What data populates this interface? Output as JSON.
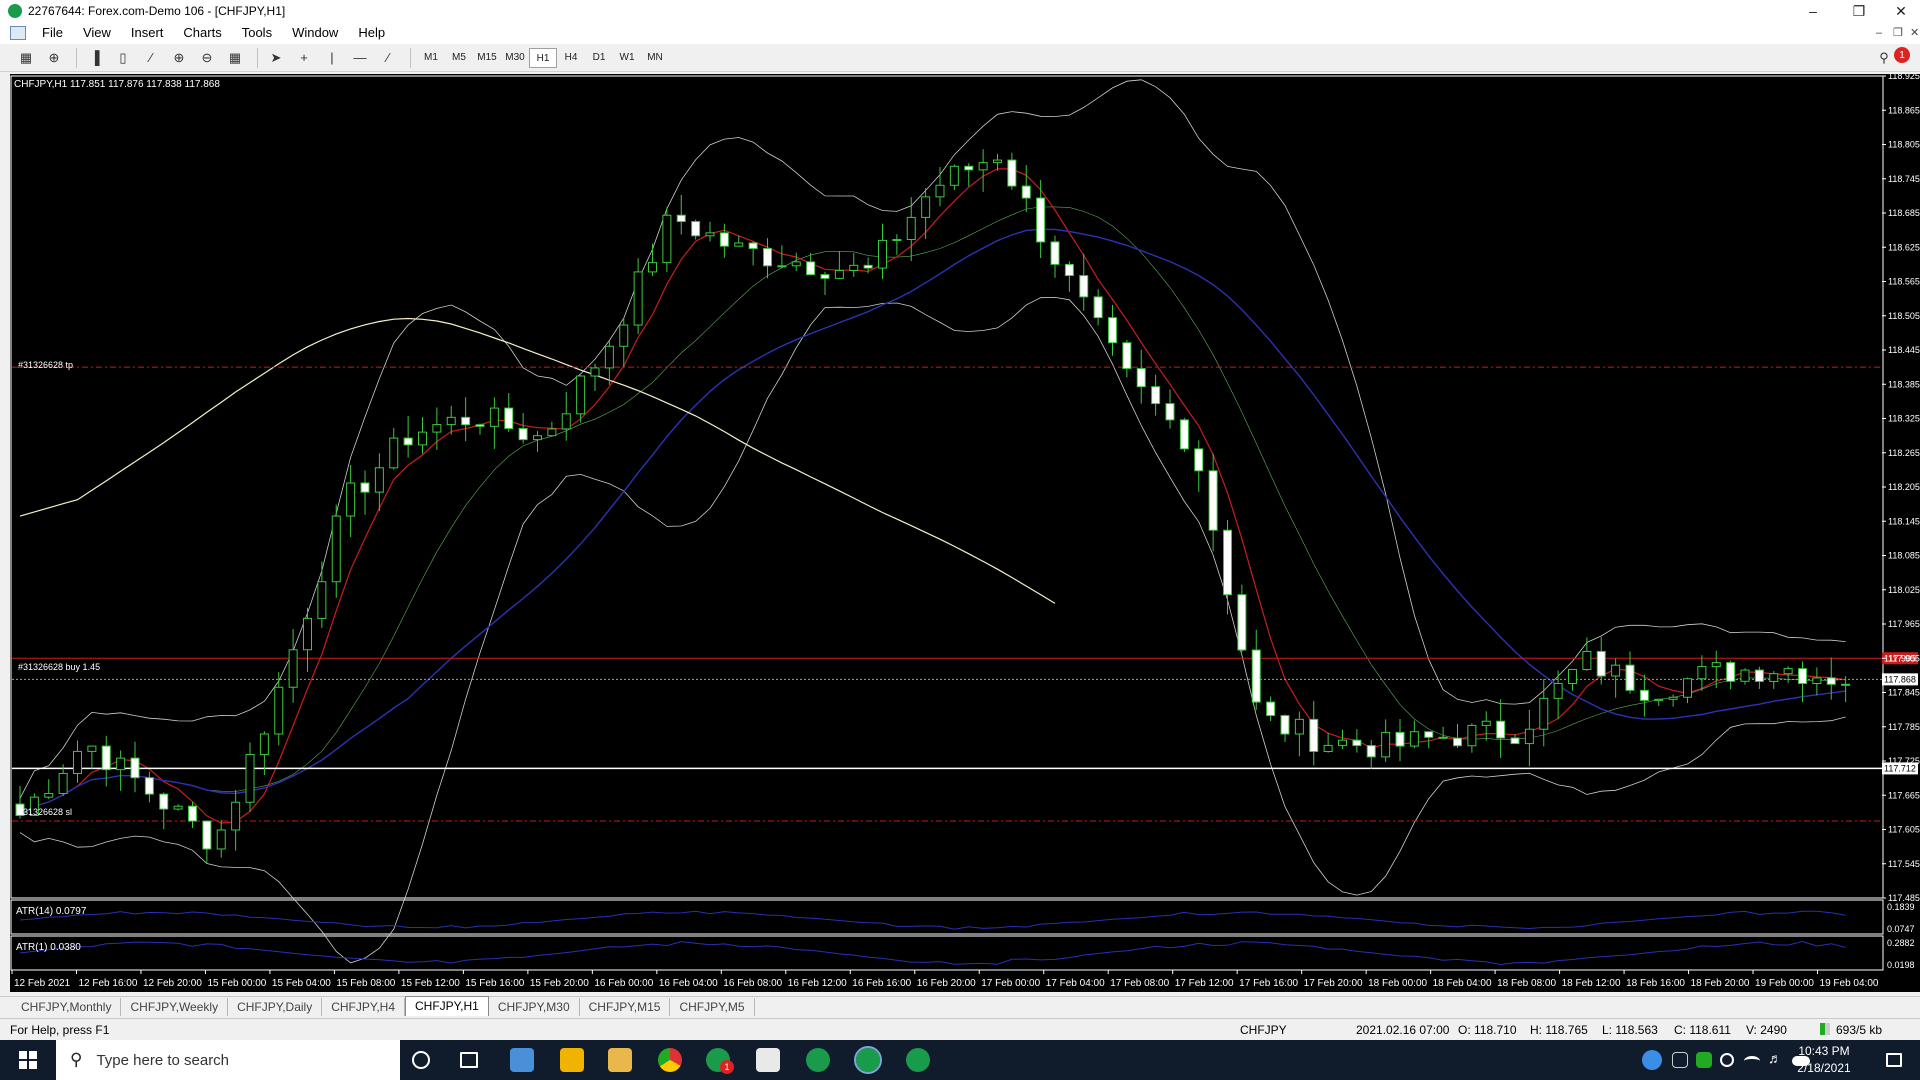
{
  "window": {
    "title": "22767644: Forex.com-Demo 106 - [CHFJPY,H1]"
  },
  "menu": [
    "File",
    "View",
    "Insert",
    "Charts",
    "Tools",
    "Window",
    "Help"
  ],
  "timeframes": [
    "M1",
    "M5",
    "M15",
    "M30",
    "H1",
    "H4",
    "D1",
    "W1",
    "MN"
  ],
  "active_timeframe": "H1",
  "chart": {
    "header": "CHFJPY,H1  117.851 117.876 117.838 117.868",
    "tp_label": "#31326628 tp",
    "buy_label": "#31326628 buy 1.45",
    "sl_label": "#31326628 sl",
    "price_labels": [
      "118.925",
      "118.865",
      "118.805",
      "118.745",
      "118.685",
      "118.625",
      "118.565",
      "118.505",
      "118.445",
      "118.385",
      "118.325",
      "118.265",
      "118.205",
      "118.145",
      "118.085",
      "118.025",
      "117.965",
      "117.905",
      "117.845",
      "117.785",
      "117.725",
      "117.665",
      "117.605",
      "117.545",
      "117.485"
    ],
    "current_price": "117.868",
    "buy_price_tag": "117.905",
    "hline_price": "117.712",
    "atr14_label": "ATR(14) 0.0797",
    "atr14_scale": [
      "0.1839",
      "0.0747"
    ],
    "atr1_label": "ATR(1) 0.0380",
    "atr1_scale": [
      "0.2882",
      "0.0198"
    ],
    "time_labels": [
      "12 Feb 2021",
      "12 Feb 16:00",
      "12 Feb 20:00",
      "15 Feb 00:00",
      "15 Feb 04:00",
      "15 Feb 08:00",
      "15 Feb 12:00",
      "15 Feb 16:00",
      "15 Feb 20:00",
      "16 Feb 00:00",
      "16 Feb 04:00",
      "16 Feb 08:00",
      "16 Feb 12:00",
      "16 Feb 16:00",
      "16 Feb 20:00",
      "17 Feb 00:00",
      "17 Feb 04:00",
      "17 Feb 08:00",
      "17 Feb 12:00",
      "17 Feb 16:00",
      "17 Feb 20:00",
      "18 Feb 00:00",
      "18 Feb 04:00",
      "18 Feb 08:00",
      "18 Feb 12:00",
      "18 Feb 16:00",
      "18 Feb 20:00",
      "19 Feb 00:00",
      "19 Feb 04:00"
    ],
    "colors": {
      "background": "#000000",
      "bull_candle": "#000000",
      "bear_candle": "#ffffff",
      "wick": "#3cc83c",
      "ma_fast": "#c81e1e",
      "ma_slow": "#2d32b4",
      "ma_long": "#f5f0c8",
      "bands": "#c8d2c8",
      "tp_sl_line": "#c81e1e",
      "buy_line": "#c81e1e",
      "atr": "#2830b4"
    }
  },
  "chart_data": {
    "type": "candlestick",
    "symbol": "CHFJPY",
    "timeframe": "H1",
    "ylim": [
      117.485,
      118.925
    ],
    "x": [
      "12 Feb 2021",
      "12 Feb 16:00",
      "12 Feb 20:00",
      "15 Feb 00:00",
      "15 Feb 04:00",
      "15 Feb 08:00",
      "15 Feb 12:00",
      "15 Feb 16:00",
      "15 Feb 20:00",
      "16 Feb 00:00",
      "16 Feb 04:00",
      "16 Feb 08:00",
      "16 Feb 12:00",
      "16 Feb 16:00",
      "16 Feb 20:00",
      "17 Feb 00:00",
      "17 Feb 04:00",
      "17 Feb 08:00",
      "17 Feb 12:00",
      "17 Feb 16:00",
      "17 Feb 20:00",
      "18 Feb 00:00",
      "18 Feb 04:00",
      "18 Feb 08:00",
      "18 Feb 12:00",
      "18 Feb 16:00",
      "18 Feb 20:00",
      "19 Feb 00:00",
      "19 Feb 04:00"
    ],
    "close_approx": [
      117.63,
      117.76,
      117.67,
      117.58,
      117.86,
      118.18,
      118.3,
      118.33,
      118.29,
      118.45,
      118.68,
      118.62,
      118.6,
      118.58,
      118.73,
      118.79,
      118.58,
      118.39,
      118.28,
      117.8,
      117.76,
      117.75,
      117.77,
      117.78,
      117.9,
      117.85,
      117.88,
      117.89,
      117.868
    ],
    "levels": {
      "tp": 118.415,
      "buy": 117.905,
      "sl": 117.62,
      "horizontal_line": 117.712,
      "current": 117.868
    },
    "indicators": [
      "ATR(14) 0.0797",
      "ATR(1) 0.0380"
    ]
  },
  "tabs": [
    "CHFJPY,Monthly",
    "CHFJPY,Weekly",
    "CHFJPY,Daily",
    "CHFJPY,H4",
    "CHFJPY,H1",
    "CHFJPY,M30",
    "CHFJPY,M15",
    "CHFJPY,M5"
  ],
  "active_tab": "CHFJPY,H1",
  "status": {
    "help": "For Help, press F1",
    "symbol": "CHFJPY",
    "datetime": "2021.02.16 07:00",
    "open": "O: 118.710",
    "high": "H: 118.765",
    "low": "L: 118.563",
    "close": "C: 118.611",
    "volume": "V: 2490",
    "traffic": "693/5 kb"
  },
  "taskbar": {
    "search_placeholder": "Type here to search",
    "time": "10:43 PM",
    "date": "2/18/2021",
    "badge": "1"
  }
}
